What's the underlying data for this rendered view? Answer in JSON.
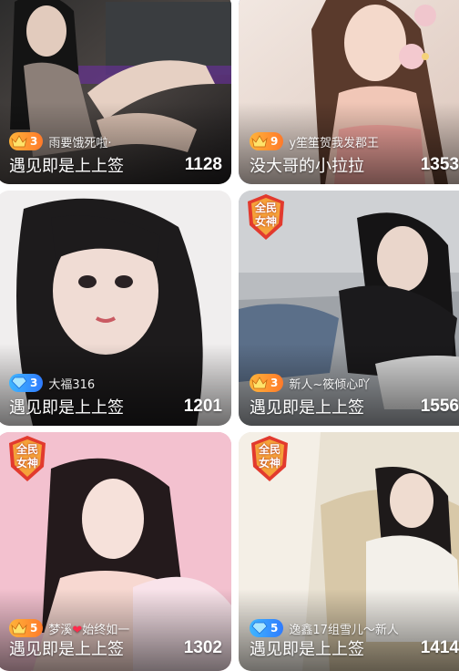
{
  "cards": [
    {
      "nick": "雨要饿死啦·",
      "level": "3",
      "badge": "crown",
      "title": "遇见即是上上签",
      "count": "1128",
      "tag": ""
    },
    {
      "nick": "y笙笙贺我发郡王",
      "level": "9",
      "badge": "crown",
      "title": "没大哥的小拉拉",
      "count": "1353",
      "tag": ""
    },
    {
      "nick": "大福316",
      "level": "3",
      "badge": "diamond",
      "title": "遇见即是上上签",
      "count": "1201",
      "tag": ""
    },
    {
      "nick": "新人~筱倾心吖",
      "level": "3",
      "badge": "crown",
      "title": "遇见即是上上签",
      "count": "1556",
      "tag_line1": "全民",
      "tag_line2": "女神"
    },
    {
      "nick_a": "梦溪",
      "nick_heart": "❤",
      "nick_b": "始终如一",
      "level": "5",
      "badge": "crown",
      "title": "遇见即是上上签",
      "count": "1302",
      "tag_line1": "全民",
      "tag_line2": "女神"
    },
    {
      "nick": "逸鑫17组雪儿～新人",
      "level": "5",
      "badge": "diamond",
      "title": "遇见即是上上签",
      "count": "1414",
      "tag_line1": "全民",
      "tag_line2": "女神"
    }
  ],
  "colors": {
    "gold_badge": "#ff9a2e",
    "blue_badge": "#2f8bff",
    "selected_border": "#5b8bd9",
    "tag_red": "#e23a2e"
  }
}
